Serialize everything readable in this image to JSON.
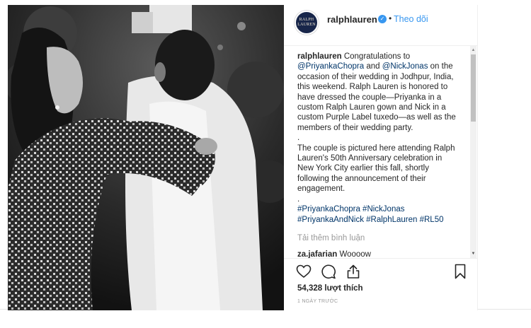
{
  "post": {
    "username": "ralphlauren",
    "follow_label": "Theo dõi",
    "separator": "•",
    "avatar_lines": [
      "RALPH",
      "LAUREN"
    ]
  },
  "caption": {
    "author": "ralphlauren",
    "text_1": " Congratulations to ",
    "mention_1": "@PriyankaChopra",
    "text_2": " and ",
    "mention_2": "@NickJonas",
    "text_3": " on the occasion of their wedding in Jodhpur, India, this weekend. Ralph Lauren is honored to have dressed the couple—Priyanka in a custom Ralph Lauren gown and Nick in a custom Purple Label tuxedo—as well as the members of their wedding party.",
    "sep_1": ".",
    "paragraph_2": "The couple is pictured here attending Ralph Lauren's 50th Anniversary celebration in New York City earlier this fall, shortly following the announcement of their engagement.",
    "sep_2": ".",
    "hashtags": "#PriyankaChopra #NickJonas #PriyankaAndNick #RalphLauren #RL50"
  },
  "load_more": "Tải thêm bình luận",
  "comment": {
    "user": "za.jafarian",
    "text": "Woooow"
  },
  "likes": "54,328 lượt thích",
  "timestamp": "1 NGÀY TRƯỚC",
  "icons": {
    "like": "heart-icon",
    "comment": "comment-icon",
    "share": "share-icon",
    "save": "bookmark-icon",
    "verified": "verified-badge-icon"
  },
  "colors": {
    "accent": "#3897f0",
    "link": "#003569",
    "muted": "#999999",
    "text": "#262626"
  }
}
